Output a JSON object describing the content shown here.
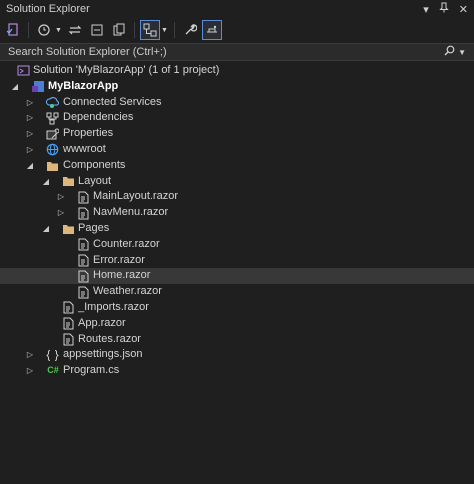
{
  "window": {
    "title": "Solution Explorer"
  },
  "search": {
    "placeholder": "Search Solution Explorer (Ctrl+;)"
  },
  "tree": {
    "solution": "Solution 'MyBlazorApp' (1 of 1 project)",
    "project": "MyBlazorApp",
    "connected_services": "Connected Services",
    "dependencies": "Dependencies",
    "properties": "Properties",
    "wwwroot": "wwwroot",
    "components": "Components",
    "layout": "Layout",
    "main_layout": "MainLayout.razor",
    "nav_menu": "NavMenu.razor",
    "pages": "Pages",
    "counter": "Counter.razor",
    "error": "Error.razor",
    "home": "Home.razor",
    "weather": "Weather.razor",
    "imports": "_Imports.razor",
    "app": "App.razor",
    "routes": "Routes.razor",
    "appsettings": "appsettings.json",
    "program": "Program.cs"
  },
  "colors": {
    "accent": "#5a8dd6",
    "selection": "#383838",
    "folder": "#dcb67a",
    "csharp": "#4ec94e"
  }
}
